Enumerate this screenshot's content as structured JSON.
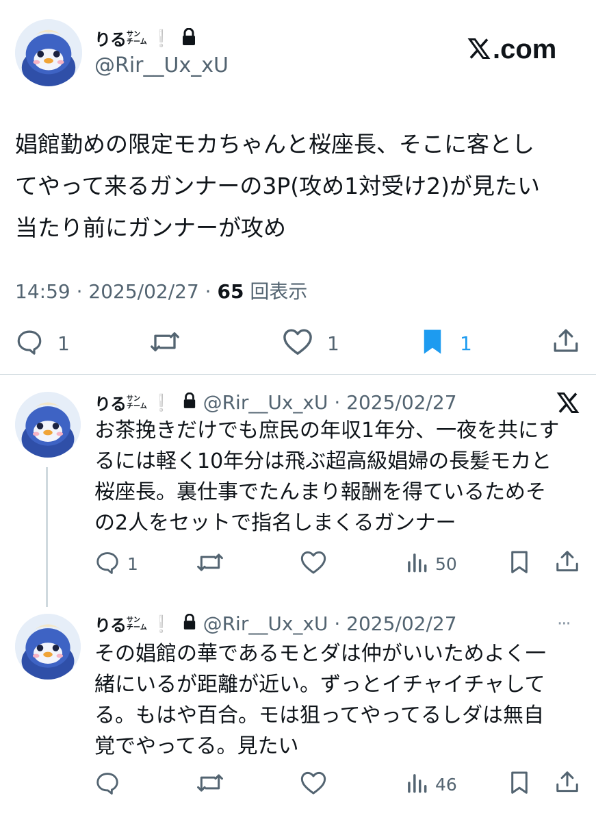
{
  "main_post": {
    "name_big": "りる",
    "name_small_top": "サン",
    "name_small_bottom": "チーム",
    "excl": "❕",
    "handle": "@Rir__Ux_xU",
    "brand": "𝕏.com",
    "text_lines": [
      "娼館勤めの限定モカちゃんと桜座長、そこに客とし",
      "てやって来るガンナーの3P(攻め1対受け2)が見たい",
      "当たり前にガンナーが攻め"
    ],
    "time": "14:59 · 2025/02/27 · ",
    "views": "65",
    "views_label": " 回表示",
    "counts": {
      "replies": "1",
      "reposts": "",
      "likes": "1",
      "bookmarks": "1"
    },
    "accent": "#1d9bf0"
  },
  "reply1": {
    "name_big": "りる",
    "name_small_top": "サン",
    "name_small_bottom": "チーム",
    "excl": "❕",
    "handle_date": "@Rir__Ux_xU · 2025/02/27",
    "text_lines": [
      "お茶挽きだけでも庶民の年収1年分、一夜を共にす",
      "るには軽く10年分は飛ぶ超高級娼婦の長髪モカと",
      "桜座長。裏仕事でたんまり報酬を得ているためそ",
      "の2人をセットで指名しまくるガンナー"
    ],
    "counts": {
      "replies": "1",
      "reposts": "",
      "likes": "",
      "views": "50"
    }
  },
  "reply2": {
    "name_big": "りる",
    "name_small_top": "サン",
    "name_small_bottom": "チーム",
    "excl": "❕",
    "handle_date": "@Rir__Ux_xU · 2025/02/27",
    "more": "···",
    "text_lines": [
      "その娼館の華であるモとダは仲がいいためよく一",
      "緒にいるが距離が近い。ずっとイチャイチャして",
      "る。もはや百合。モは狙ってやってるしダは無自",
      "覚でやってる。見たい"
    ],
    "counts": {
      "replies": "",
      "reposts": "",
      "likes": "",
      "views": "46"
    }
  },
  "icons": [
    "lock-icon",
    "x-logo-icon",
    "reply-icon",
    "repost-icon",
    "like-icon",
    "bookmark-icon",
    "share-icon",
    "views-icon",
    "more-icon"
  ]
}
